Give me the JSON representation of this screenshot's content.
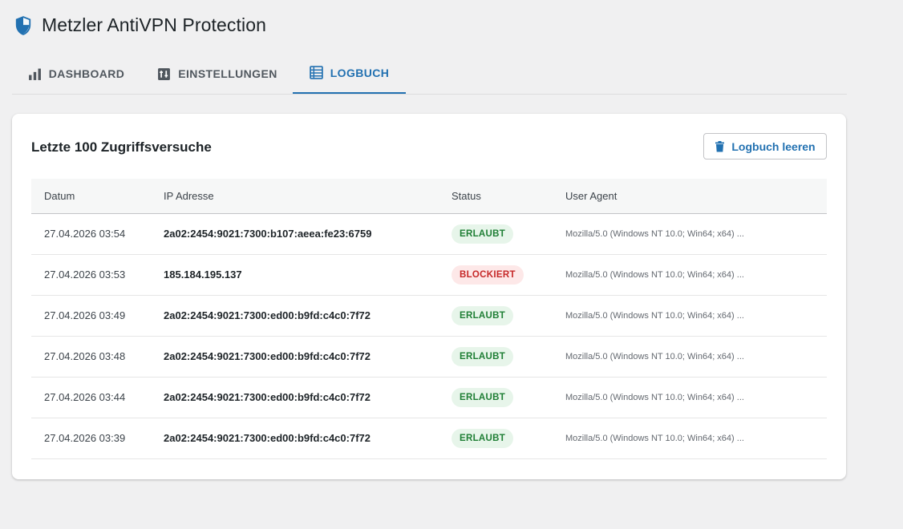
{
  "app": {
    "title": "Metzler AntiVPN Protection"
  },
  "tabs": [
    {
      "label": "DASHBOARD",
      "icon": "bar-chart-icon",
      "active": false
    },
    {
      "label": "EINSTELLUNGEN",
      "icon": "settings-icon",
      "active": false
    },
    {
      "label": "LOGBUCH",
      "icon": "list-icon",
      "active": true
    }
  ],
  "log": {
    "title": "Letzte 100 Zugriffsversuche",
    "clear_button": "Logbuch leeren",
    "columns": [
      "Datum",
      "IP Adresse",
      "Status",
      "User Agent"
    ],
    "rows": [
      {
        "date": "27.04.2026 03:54",
        "ip": "2a02:2454:9021:7300:b107:aeea:fe23:6759",
        "status": "ERLAUBT",
        "ua": "Mozilla/5.0 (Windows NT 10.0; Win64; x64) ..."
      },
      {
        "date": "27.04.2026 03:53",
        "ip": "185.184.195.137",
        "status": "BLOCKIERT",
        "ua": "Mozilla/5.0 (Windows NT 10.0; Win64; x64) ..."
      },
      {
        "date": "27.04.2026 03:49",
        "ip": "2a02:2454:9021:7300:ed00:b9fd:c4c0:7f72",
        "status": "ERLAUBT",
        "ua": "Mozilla/5.0 (Windows NT 10.0; Win64; x64) ..."
      },
      {
        "date": "27.04.2026 03:48",
        "ip": "2a02:2454:9021:7300:ed00:b9fd:c4c0:7f72",
        "status": "ERLAUBT",
        "ua": "Mozilla/5.0 (Windows NT 10.0; Win64; x64) ..."
      },
      {
        "date": "27.04.2026 03:44",
        "ip": "2a02:2454:9021:7300:ed00:b9fd:c4c0:7f72",
        "status": "ERLAUBT",
        "ua": "Mozilla/5.0 (Windows NT 10.0; Win64; x64) ..."
      },
      {
        "date": "27.04.2026 03:39",
        "ip": "2a02:2454:9021:7300:ed00:b9fd:c4c0:7f72",
        "status": "ERLAUBT",
        "ua": "Mozilla/5.0 (Windows NT 10.0; Win64; x64) ..."
      }
    ]
  },
  "colors": {
    "accent": "#2271b1",
    "allowed_bg": "#e7f5ea",
    "allowed_text": "#1e7e34",
    "blocked_bg": "#fde8e8",
    "blocked_text": "#c62828"
  }
}
